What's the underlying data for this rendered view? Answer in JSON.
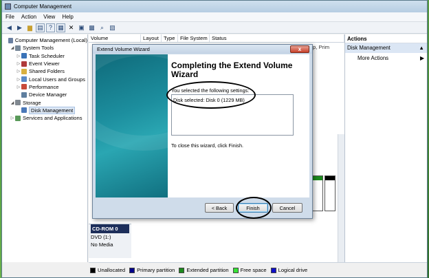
{
  "window": {
    "title": "Computer Management"
  },
  "menu": [
    "File",
    "Action",
    "View",
    "Help"
  ],
  "toolbar": {
    "icons": [
      "back-arrow-icon",
      "forward-arrow-icon",
      "folder-icon",
      "console-tree-icon",
      "help-icon",
      "properties-icon",
      "delete-icon",
      "x-icon",
      "settings-icon",
      "search-icon",
      "zoom-icon"
    ]
  },
  "tree": [
    {
      "label": "Computer Management (Local)",
      "indent": 0,
      "twisty": "",
      "icon_color": "#6a7fa0"
    },
    {
      "label": "System Tools",
      "indent": 1,
      "twisty": "◢",
      "icon_color": "#7a8a9a"
    },
    {
      "label": "Task Scheduler",
      "indent": 2,
      "twisty": "▷",
      "icon_color": "#3a73b8"
    },
    {
      "label": "Event Viewer",
      "indent": 2,
      "twisty": "▷",
      "icon_color": "#b03a3a"
    },
    {
      "label": "Shared Folders",
      "indent": 2,
      "twisty": "▷",
      "icon_color": "#d9b040"
    },
    {
      "label": "Local Users and Groups",
      "indent": 2,
      "twisty": "▷",
      "icon_color": "#5a8ac8"
    },
    {
      "label": "Performance",
      "indent": 2,
      "twisty": "▷",
      "icon_color": "#c84a3a"
    },
    {
      "label": "Device Manager",
      "indent": 2,
      "twisty": "",
      "icon_color": "#5f7f9f"
    },
    {
      "label": "Storage",
      "indent": 1,
      "twisty": "◢",
      "icon_color": "#808890"
    },
    {
      "label": "Disk Management",
      "indent": 2,
      "twisty": "",
      "icon_color": "#4a78b8",
      "selected": true
    },
    {
      "label": "Services and Applications",
      "indent": 1,
      "twisty": "▷",
      "icon_color": "#5a9a5a"
    }
  ],
  "columns": [
    "Volume",
    "Layout",
    "Type",
    "File System",
    "Status"
  ],
  "behind_text": "Dump, Prim",
  "cdrom": {
    "header": "CD-ROM 0",
    "type": "DVD (1:)",
    "status": "No Media"
  },
  "actions": {
    "header": "Actions",
    "section": "Disk Management",
    "item": "More Actions"
  },
  "legend": [
    {
      "label": "Unallocated",
      "color": "#000000"
    },
    {
      "label": "Primary partition",
      "color": "#00008b"
    },
    {
      "label": "Extended partition",
      "color": "#1e8a1e"
    },
    {
      "label": "Free space",
      "color": "#36e236"
    },
    {
      "label": "Logical drive",
      "color": "#1010c8"
    }
  ],
  "dialog": {
    "title": "Extend Volume Wizard",
    "close_symbol": "x",
    "heading": "Completing the Extend Volume Wizard",
    "settings_label": "You selected the following settings:",
    "settings_text": "Disk selected: Disk 0 (1229 MB)",
    "finish_note": "To close this wizard, click Finish.",
    "back_label": "< Back",
    "finish_label": "Finish",
    "cancel_label": "Cancel"
  }
}
